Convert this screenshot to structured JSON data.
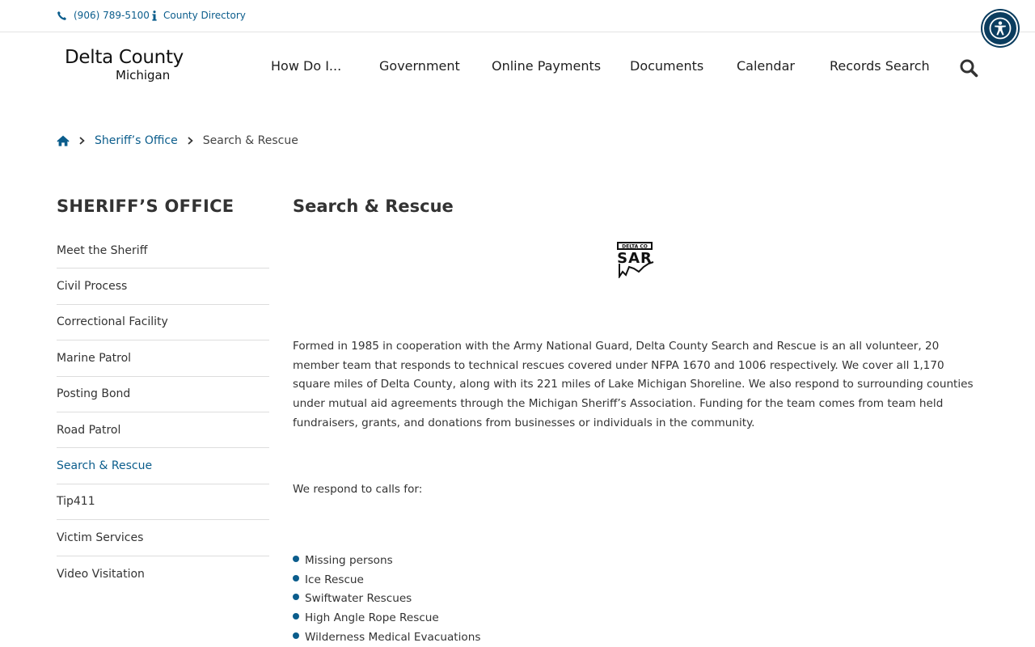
{
  "topbar": {
    "phone": "(906) 789-5100",
    "directory": "County Directory"
  },
  "logo": {
    "line1": "Delta County",
    "line2": "Michigan"
  },
  "nav": [
    {
      "label": "How Do I..."
    },
    {
      "label": "Government"
    },
    {
      "label": "Online Payments"
    },
    {
      "label": "Documents"
    },
    {
      "label": "Calendar"
    },
    {
      "label": "Records Search"
    }
  ],
  "breadcrumb": {
    "parent": "Sheriff’s Office",
    "current": "Search & Rescue"
  },
  "sidebar": {
    "title": "SHERIFF’S OFFICE",
    "items": [
      {
        "label": "Meet the Sheriff",
        "active": false
      },
      {
        "label": "Civil Process",
        "active": false
      },
      {
        "label": "Correctional Facility",
        "active": false
      },
      {
        "label": "Marine Patrol",
        "active": false
      },
      {
        "label": "Posting Bond",
        "active": false
      },
      {
        "label": "Road Patrol",
        "active": false
      },
      {
        "label": "Search & Rescue",
        "active": true
      },
      {
        "label": "Tip411",
        "active": false
      },
      {
        "label": "Victim Services",
        "active": false
      },
      {
        "label": "Video Visitation",
        "active": false
      }
    ]
  },
  "main": {
    "title": "Search & Rescue",
    "sar_logo": {
      "top_text": "DELTA CO",
      "main_text": "SAR"
    },
    "paragraph": "Formed in 1985 in cooperation with the Army National Guard, Delta County Search and Rescue is an all volunteer, 20 member team that responds to technical rescues covered under NFPA 1670 and 1006 respectively. We cover all 1,170 square miles of Delta County, along with its 221 miles of Lake Michigan Shoreline. We also respond to surrounding counties under mutual aid agreements through the Michigan Sheriff’s Association. Funding for the team comes from team held fundraisers, grants, and donations from businesses or individuals in the community.",
    "calls_intro": "We respond to calls for:",
    "calls": [
      "Missing persons",
      "Ice Rescue",
      "Swiftwater Rescues",
      "High Angle Rope Rescue",
      "Wilderness Medical Evacuations"
    ]
  },
  "colors": {
    "link": "#0b5d8c",
    "accessibility_button": "#0b3d5f",
    "text": "#333333"
  },
  "icons": [
    "phone-icon",
    "info-icon",
    "accessibility-icon",
    "search-icon",
    "home-icon",
    "chevron-right-icon"
  ]
}
